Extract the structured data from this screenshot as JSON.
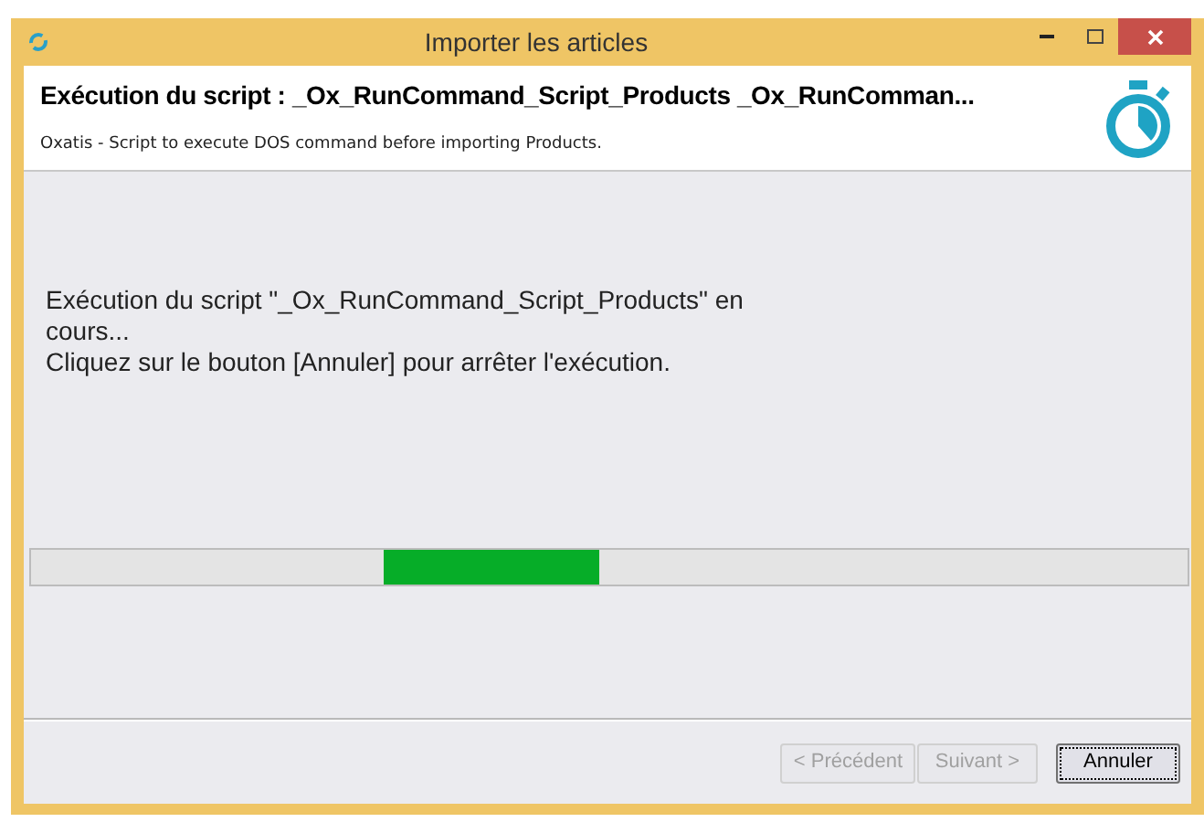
{
  "window": {
    "title": "Importer les articles"
  },
  "header": {
    "title": "Exécution du script :  _Ox_RunCommand_Script_Products _Ox_RunComman...",
    "subtitle": "Oxatis - Script to execute DOS command before importing Products."
  },
  "message": {
    "lines": [
      "Exécution du script \"_Ox_RunCommand_Script_Products\" en cours...",
      "Cliquez sur le bouton [Annuler] pour arrêter l'exécution."
    ]
  },
  "progress": {
    "indeterminate": true
  },
  "buttons": [
    {
      "label": "< Précédent",
      "disabled": true,
      "selected": false
    },
    {
      "label": "Suivant >",
      "disabled": true,
      "selected": false
    },
    {
      "label": "Annuler",
      "disabled": false,
      "selected": true
    }
  ]
}
